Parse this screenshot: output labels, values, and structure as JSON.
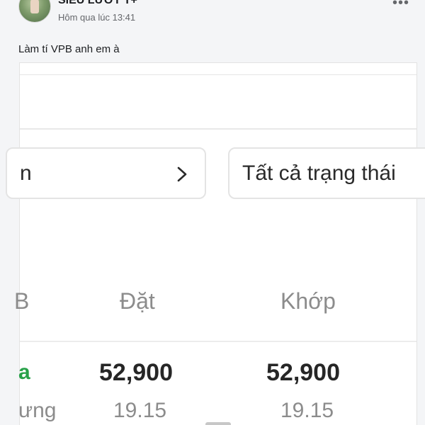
{
  "post": {
    "author": "SIÊU LƯỚT T+",
    "timestamp": "Hôm qua lúc 13:41",
    "text": "Làm tí VPB anh em à",
    "more_icon": "more-horizontal-icon"
  },
  "screenshot": {
    "filter_left": {
      "text": "n",
      "icon": "chevron-right-icon"
    },
    "filter_right": {
      "text": "Tất cả trạng thái"
    },
    "columns": [
      "B",
      "Đặt",
      "Khớp"
    ],
    "row": {
      "left_label": "a",
      "left_sub": "ưng",
      "dat_price": "52,900",
      "dat_sub": "19.15",
      "khop_price": "52,900",
      "khop_sub": "19.15"
    },
    "colors": {
      "accent_green": "#27a148",
      "muted_text": "#8c8c8c"
    }
  }
}
